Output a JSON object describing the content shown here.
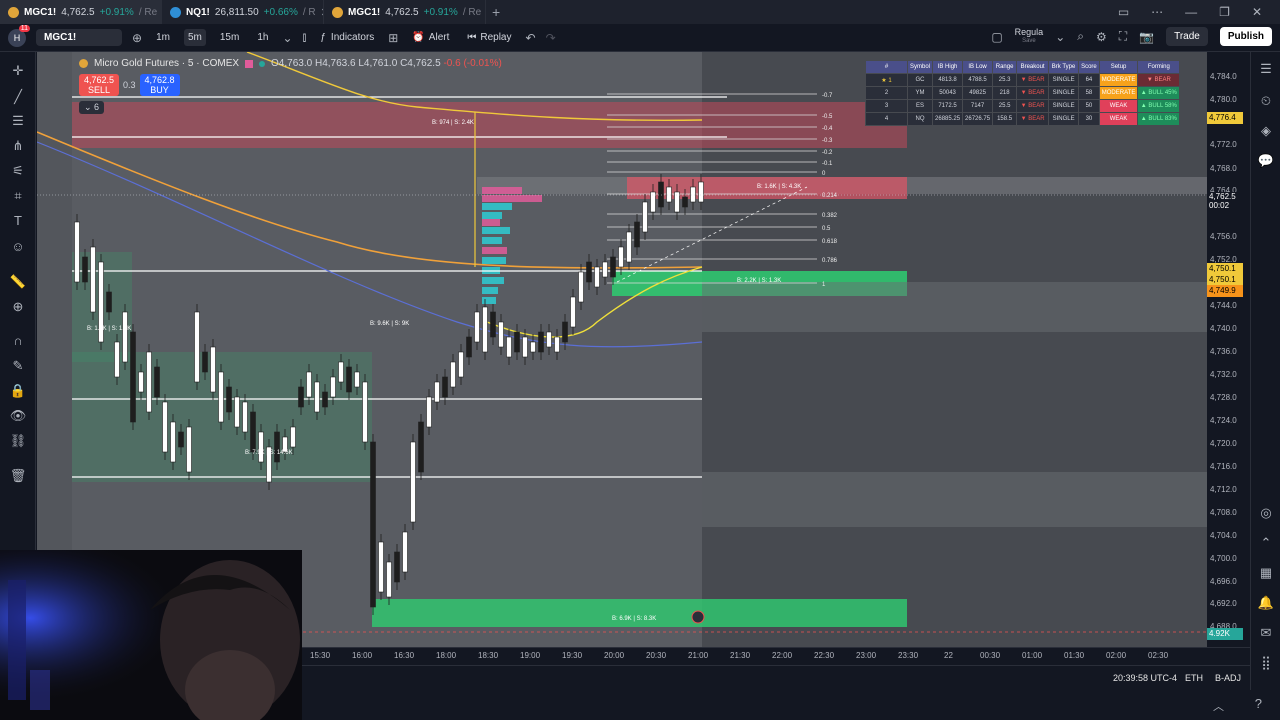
{
  "tabs": [
    {
      "symbol": "MGC1!",
      "price": "4,762.5",
      "change": "+0.91%",
      "suffix": "/ Re"
    },
    {
      "symbol": "NQ1!",
      "price": "26,811.50",
      "change": "+0.66%",
      "suffix": "/ R"
    },
    {
      "symbol": "MGC1!",
      "price": "4,762.5",
      "change": "+0.91%",
      "suffix": "/ Re"
    }
  ],
  "toolbar": {
    "avatar_badge": "11",
    "symbol": "MGC1!",
    "intervals": [
      "1m",
      "5m",
      "15m",
      "1h"
    ],
    "active_interval": "5m",
    "indicators_label": "Indicators",
    "alert_label": "Alert",
    "replay_label": "Replay",
    "layout_name": "Regula",
    "layout_sub": "Save",
    "trade_label": "Trade",
    "publish_label": "Publish"
  },
  "legend": {
    "name": "Micro Gold Futures · 5 · COMEX",
    "open": "O4,763.0",
    "high": "H4,763.6",
    "low": "L4,761.0",
    "close": "C4,762.5",
    "change": "-0.6 (-0.01%)",
    "sell_price": "4,762.5",
    "sell_label": "SELL",
    "spread": "0.3",
    "buy_price": "4,762.8",
    "buy_label": "BUY",
    "collapsed_count": "6"
  },
  "zone_labels": [
    "B: 974 | S: 2.4K",
    "B: 1.6K | S: 4.3K",
    "B: 2.2K | S: 1.3K",
    "B: 9.6K | S: 9K",
    "B: 6.9K | S: 8.3K",
    "B: 7.9K | S: 14.6K",
    "B: 1.6K | S: 1.3K"
  ],
  "fib_labels": [
    "-0.7",
    "-0.5",
    "-0.4",
    "-0.3",
    "-0.2",
    "-0.1",
    "0",
    "0.214",
    "0.382",
    "0.5",
    "0.618",
    "0.786",
    "1"
  ],
  "table": {
    "headers": [
      "#",
      "Symbol",
      "IB High",
      "IB Low",
      "Range",
      "Breakout",
      "Brk Type",
      "Score",
      "Setup",
      "Forming"
    ],
    "rows": [
      [
        "★ 1",
        "GC",
        "4813.8",
        "4788.5",
        "25.3",
        "▼ BEAR",
        "SINGLE",
        "64",
        "MODERATE",
        "▼ BEAR"
      ],
      [
        "2",
        "YM",
        "50043",
        "49825",
        "218",
        "▼ BEAR",
        "SINGLE",
        "58",
        "MODERATE",
        "▲ BULL 45%"
      ],
      [
        "3",
        "ES",
        "7172.5",
        "7147",
        "25.5",
        "▼ BEAR",
        "SINGLE",
        "50",
        "WEAK",
        "▲ BULL 58%"
      ],
      [
        "4",
        "NQ",
        "26885.25",
        "26726.75",
        "158.5",
        "▼ BEAR",
        "SINGLE",
        "30",
        "WEAK",
        "▲ BULL 83%"
      ]
    ]
  },
  "price_scale": [
    "4,784.0",
    "4,780.0",
    "4,772.0",
    "4,768.0",
    "4,764.0",
    "4,756.0",
    "4,752.0",
    "4,744.0",
    "4,740.0",
    "4,736.0",
    "4,732.0",
    "4,728.0",
    "4,724.0",
    "4,720.0",
    "4,716.0",
    "4,712.0",
    "4,708.0",
    "4,704.0",
    "4,700.0",
    "4,696.0",
    "4,692.0",
    "4,688.0"
  ],
  "price_tags": {
    "top": "4,776.4",
    "current": "4,762.5",
    "countdown": "00:02",
    "t1": "4,750.1",
    "t2": "4,750.1",
    "t3": "4,749.9",
    "volume": "4.92K"
  },
  "time_scale": [
    "15:00",
    "15:30",
    "16:00",
    "16:30",
    "18:00",
    "18:30",
    "19:00",
    "19:30",
    "20:00",
    "20:30",
    "21:00",
    "21:30",
    "22:00",
    "22:30",
    "23:00",
    "23:30",
    "22",
    "00:30",
    "01:00",
    "01:30",
    "02:00",
    "02:30"
  ],
  "status": {
    "clock": "20:39:58 UTC-4",
    "session": "ETH",
    "adj": "B-ADJ"
  },
  "colors": {
    "bg": "#474a50",
    "up": "#26a69a",
    "down": "#ef5350",
    "accent_yellow": "#f0c93a",
    "zone_green": "#2ecc71",
    "zone_red": "#e0405a"
  }
}
